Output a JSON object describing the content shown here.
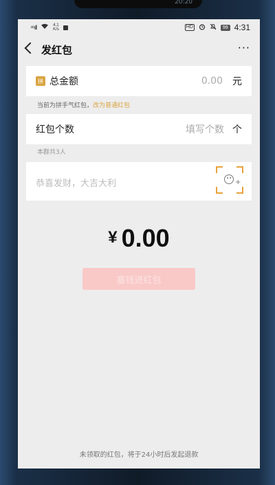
{
  "status": {
    "signal": "⁴⁶ıll",
    "speed": "4.1",
    "speed_unit": "K/s",
    "hd": "HD",
    "battery": "99",
    "time": "4:31"
  },
  "frame": {
    "notch_text": "20:20"
  },
  "nav": {
    "title": "发红包",
    "more": "···"
  },
  "amount": {
    "icon_text": "拼",
    "label": "总金额",
    "value": "0.00",
    "unit": "元"
  },
  "hint": {
    "text": "当前为拼手气红包，",
    "link": "改为普通红包"
  },
  "count": {
    "label": "红包个数",
    "placeholder": "填写个数",
    "unit": "个"
  },
  "group_hint": "本群共3人",
  "message": {
    "placeholder": "恭喜发财，大吉大利"
  },
  "total": {
    "symbol": "¥",
    "value": "0.00"
  },
  "send_button": "塞钱进红包",
  "bottom_note": "未领取的红包，将于24小时后发起退款",
  "colors": {
    "accent_gold": "#d9a441",
    "button_disabled": "#f9c9c7"
  }
}
